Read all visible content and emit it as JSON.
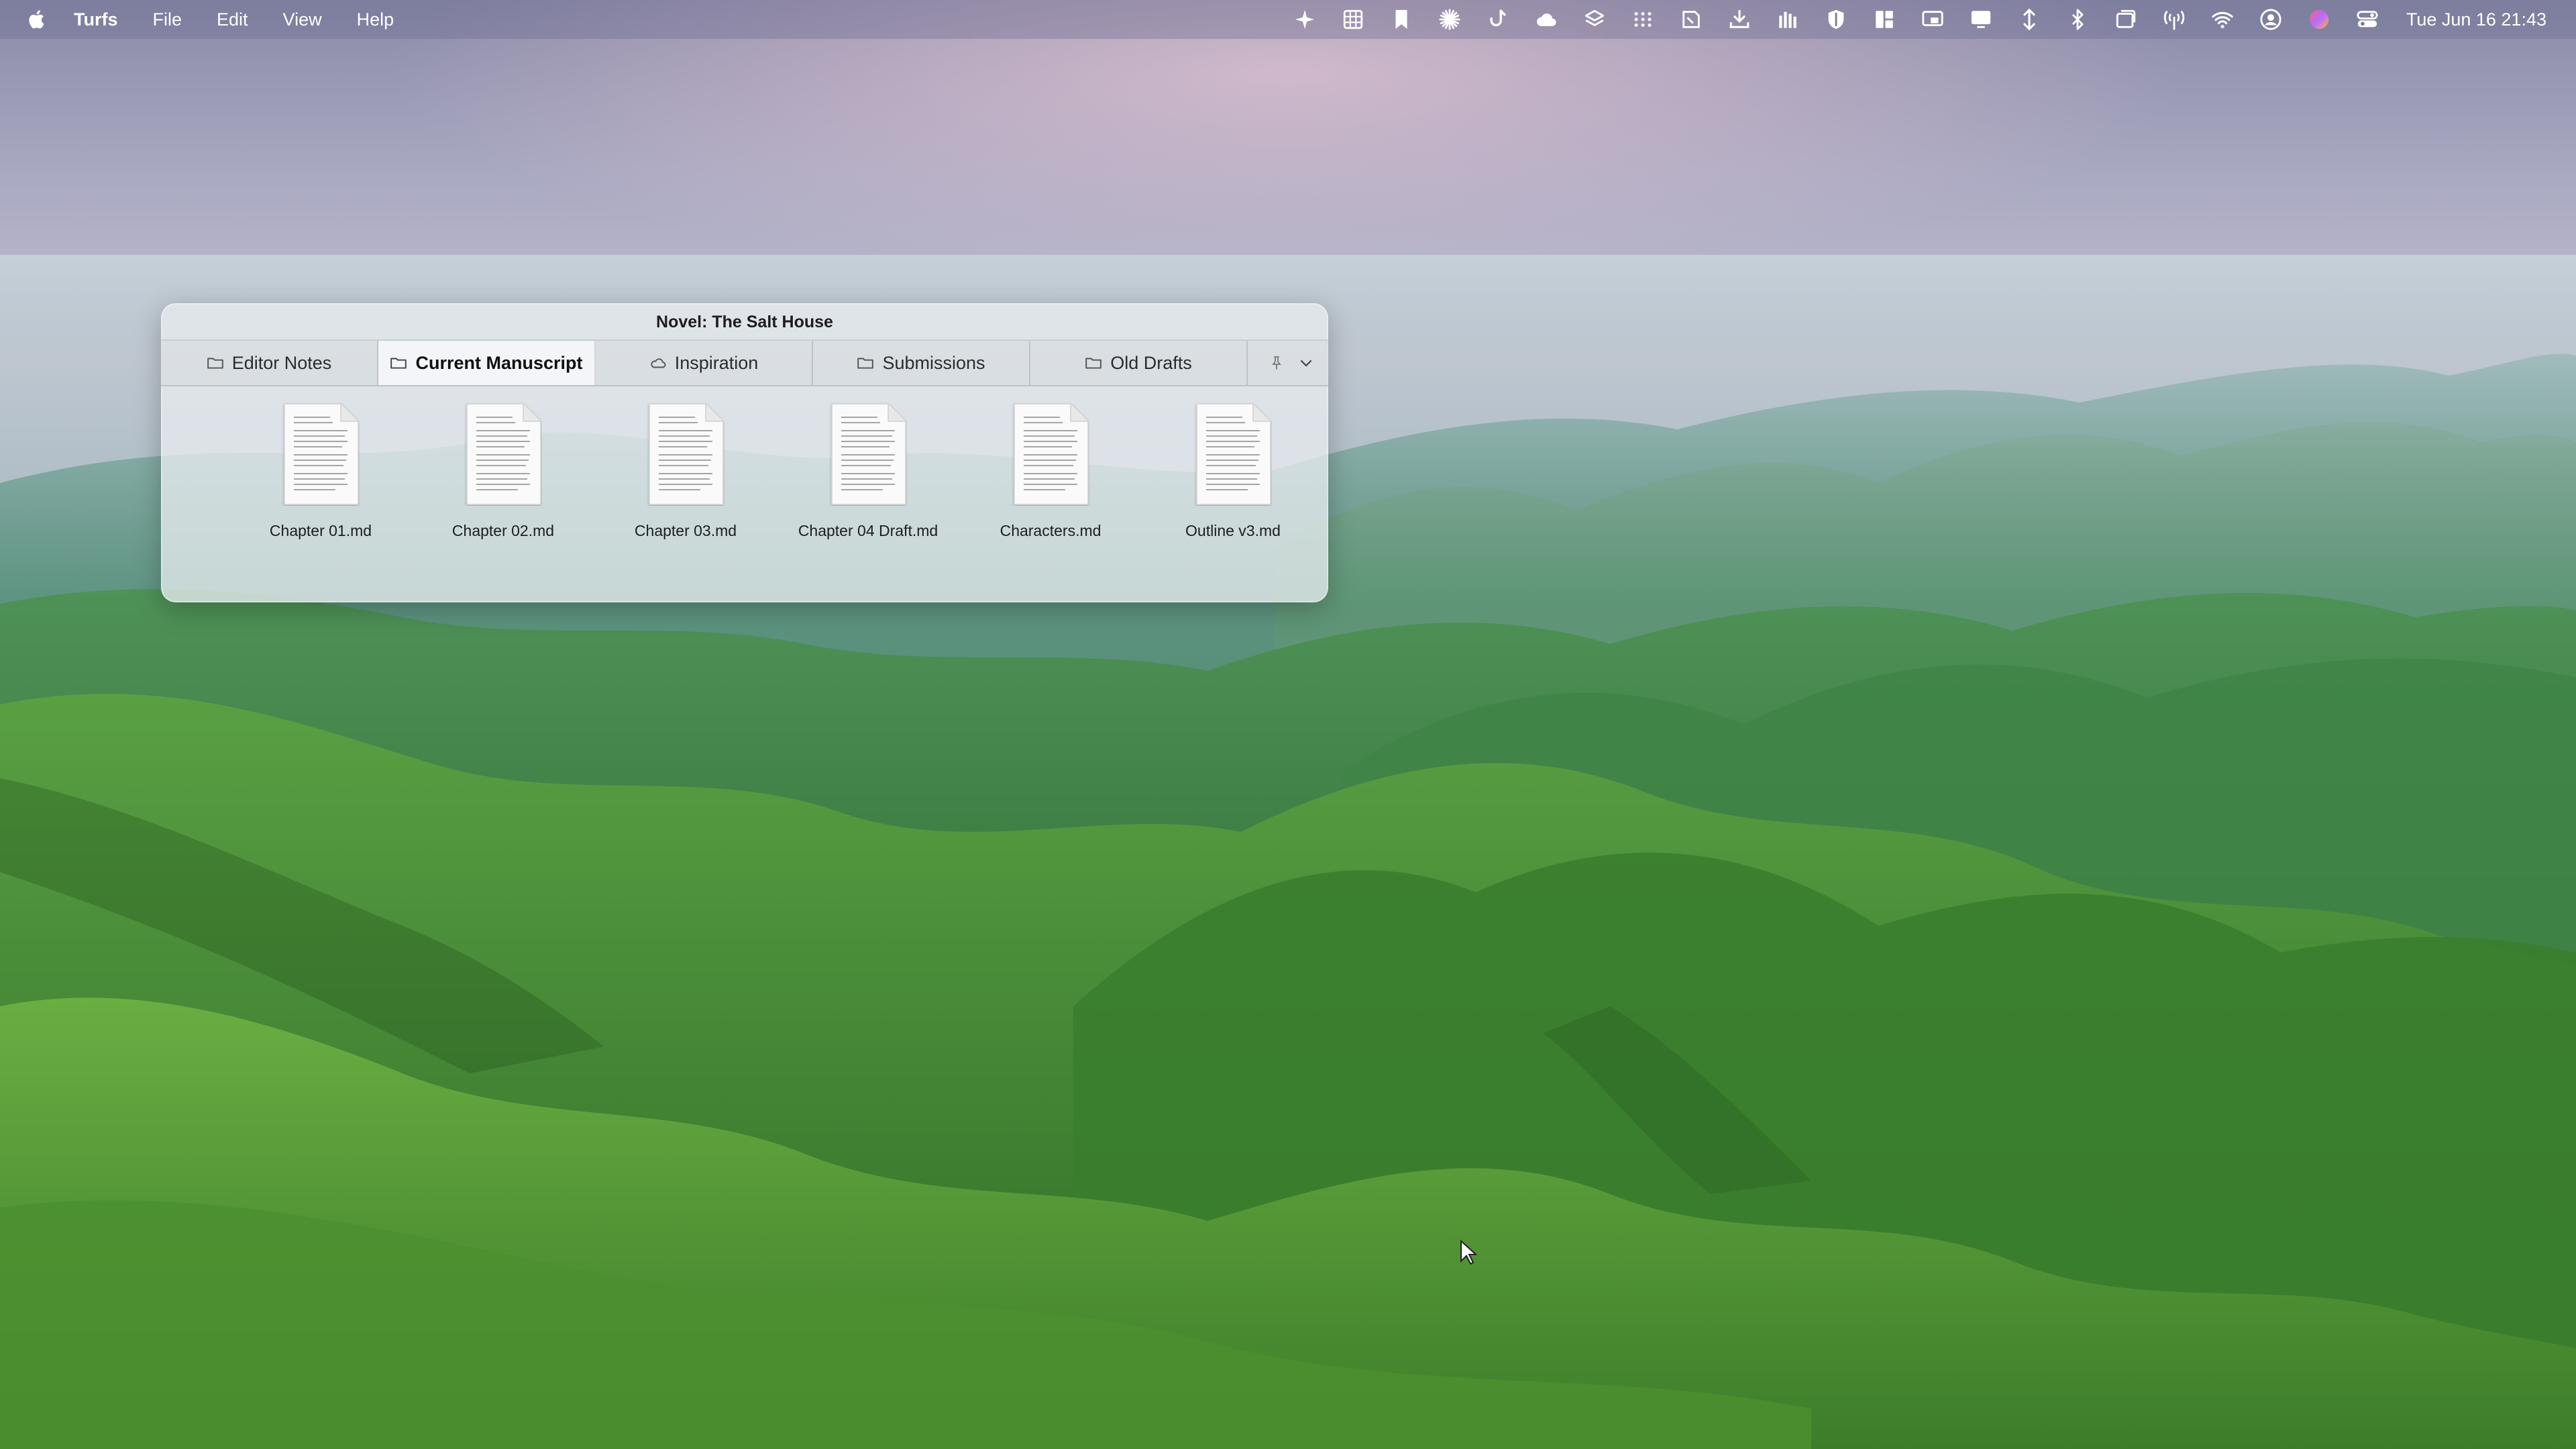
{
  "menubar": {
    "app_name": "Turfs",
    "menus": [
      "File",
      "Edit",
      "View",
      "Help"
    ],
    "clock": "Tue Jun 16  21:43",
    "status_icons": [
      "sparkle-icon",
      "grid-calculator-icon",
      "bookmark-icon",
      "sun-burst-icon",
      "hook-icon",
      "cloud-icon",
      "layers-icon",
      "dots-grid-icon",
      "note-icon",
      "download-tray-icon",
      "candles-icon",
      "shield-icon",
      "window-layout-icon",
      "screen-share-icon",
      "display-icon",
      "vertical-arrows-icon",
      "bluetooth-icon",
      "window-stack-icon",
      "antenna-icon",
      "wifi-icon",
      "user-circle-icon",
      "color-orb-icon",
      "control-center-icon"
    ]
  },
  "shelf": {
    "title": "Novel: The Salt House",
    "tabs": [
      {
        "label": "Editor Notes",
        "icon": "folder-icon",
        "active": false
      },
      {
        "label": "Current Manuscript",
        "icon": "folder-icon",
        "active": true
      },
      {
        "label": "Inspiration",
        "icon": "cloud-folder-icon",
        "active": false
      },
      {
        "label": "Submissions",
        "icon": "folder-icon",
        "active": false
      },
      {
        "label": "Old Drafts",
        "icon": "folder-icon",
        "active": false
      }
    ],
    "tools": [
      "pin-icon",
      "chevron-down-icon"
    ],
    "files": [
      {
        "name": "Chapter 01.md"
      },
      {
        "name": "Chapter 02.md"
      },
      {
        "name": "Chapter 03.md"
      },
      {
        "name": "Chapter 04 Draft.md"
      },
      {
        "name": "Characters.md"
      },
      {
        "name": "Outline v3.md"
      }
    ]
  },
  "colors": {
    "menubar_text": "#ffffff",
    "shelf_bg": "#e8ecf0",
    "active_tab": "#f6f7f9"
  }
}
